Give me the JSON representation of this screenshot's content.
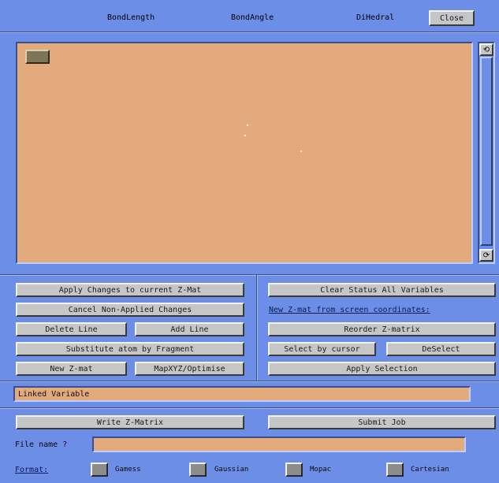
{
  "header": {
    "bond_length": "BondLength",
    "bond_angle": "BondAngle",
    "dihedral": "DiHedral",
    "close": "Close"
  },
  "scrollbar": {
    "up_icon": "up-arrow-icon",
    "down_icon": "down-arrow-icon"
  },
  "left_buttons": {
    "apply": "Apply Changes to current Z-Mat",
    "cancel": "Cancel Non-Applied Changes",
    "delete_line": "Delete Line",
    "add_line": "Add Line",
    "substitute": "Substitute atom by Fragment",
    "new_zmat": "New Z-mat",
    "mapxyz": "MapXYZ/Optimise"
  },
  "right_buttons": {
    "clear_status": "Clear Status All Variables",
    "new_from_screen": "New Z-mat from screen coordinates:",
    "reorder": "Reorder Z-matrix",
    "select_by_cursor": "Select by cursor",
    "deselect": "DeSelect",
    "apply_selection": "Apply Selection"
  },
  "linked_variable": "Linked Variable",
  "write_zmatrix": "Write Z-Matrix",
  "submit_job": "Submit Job",
  "file_name_label": "File name ?",
  "file_name_value": "",
  "format": {
    "label": "Format:",
    "options": [
      "Gamess",
      "Gaussian",
      "Mopac",
      "Cartesian"
    ]
  },
  "colors": {
    "background": "#6d8ee6",
    "canvas": "#e3aa7e",
    "button": "#c6c6c6"
  }
}
